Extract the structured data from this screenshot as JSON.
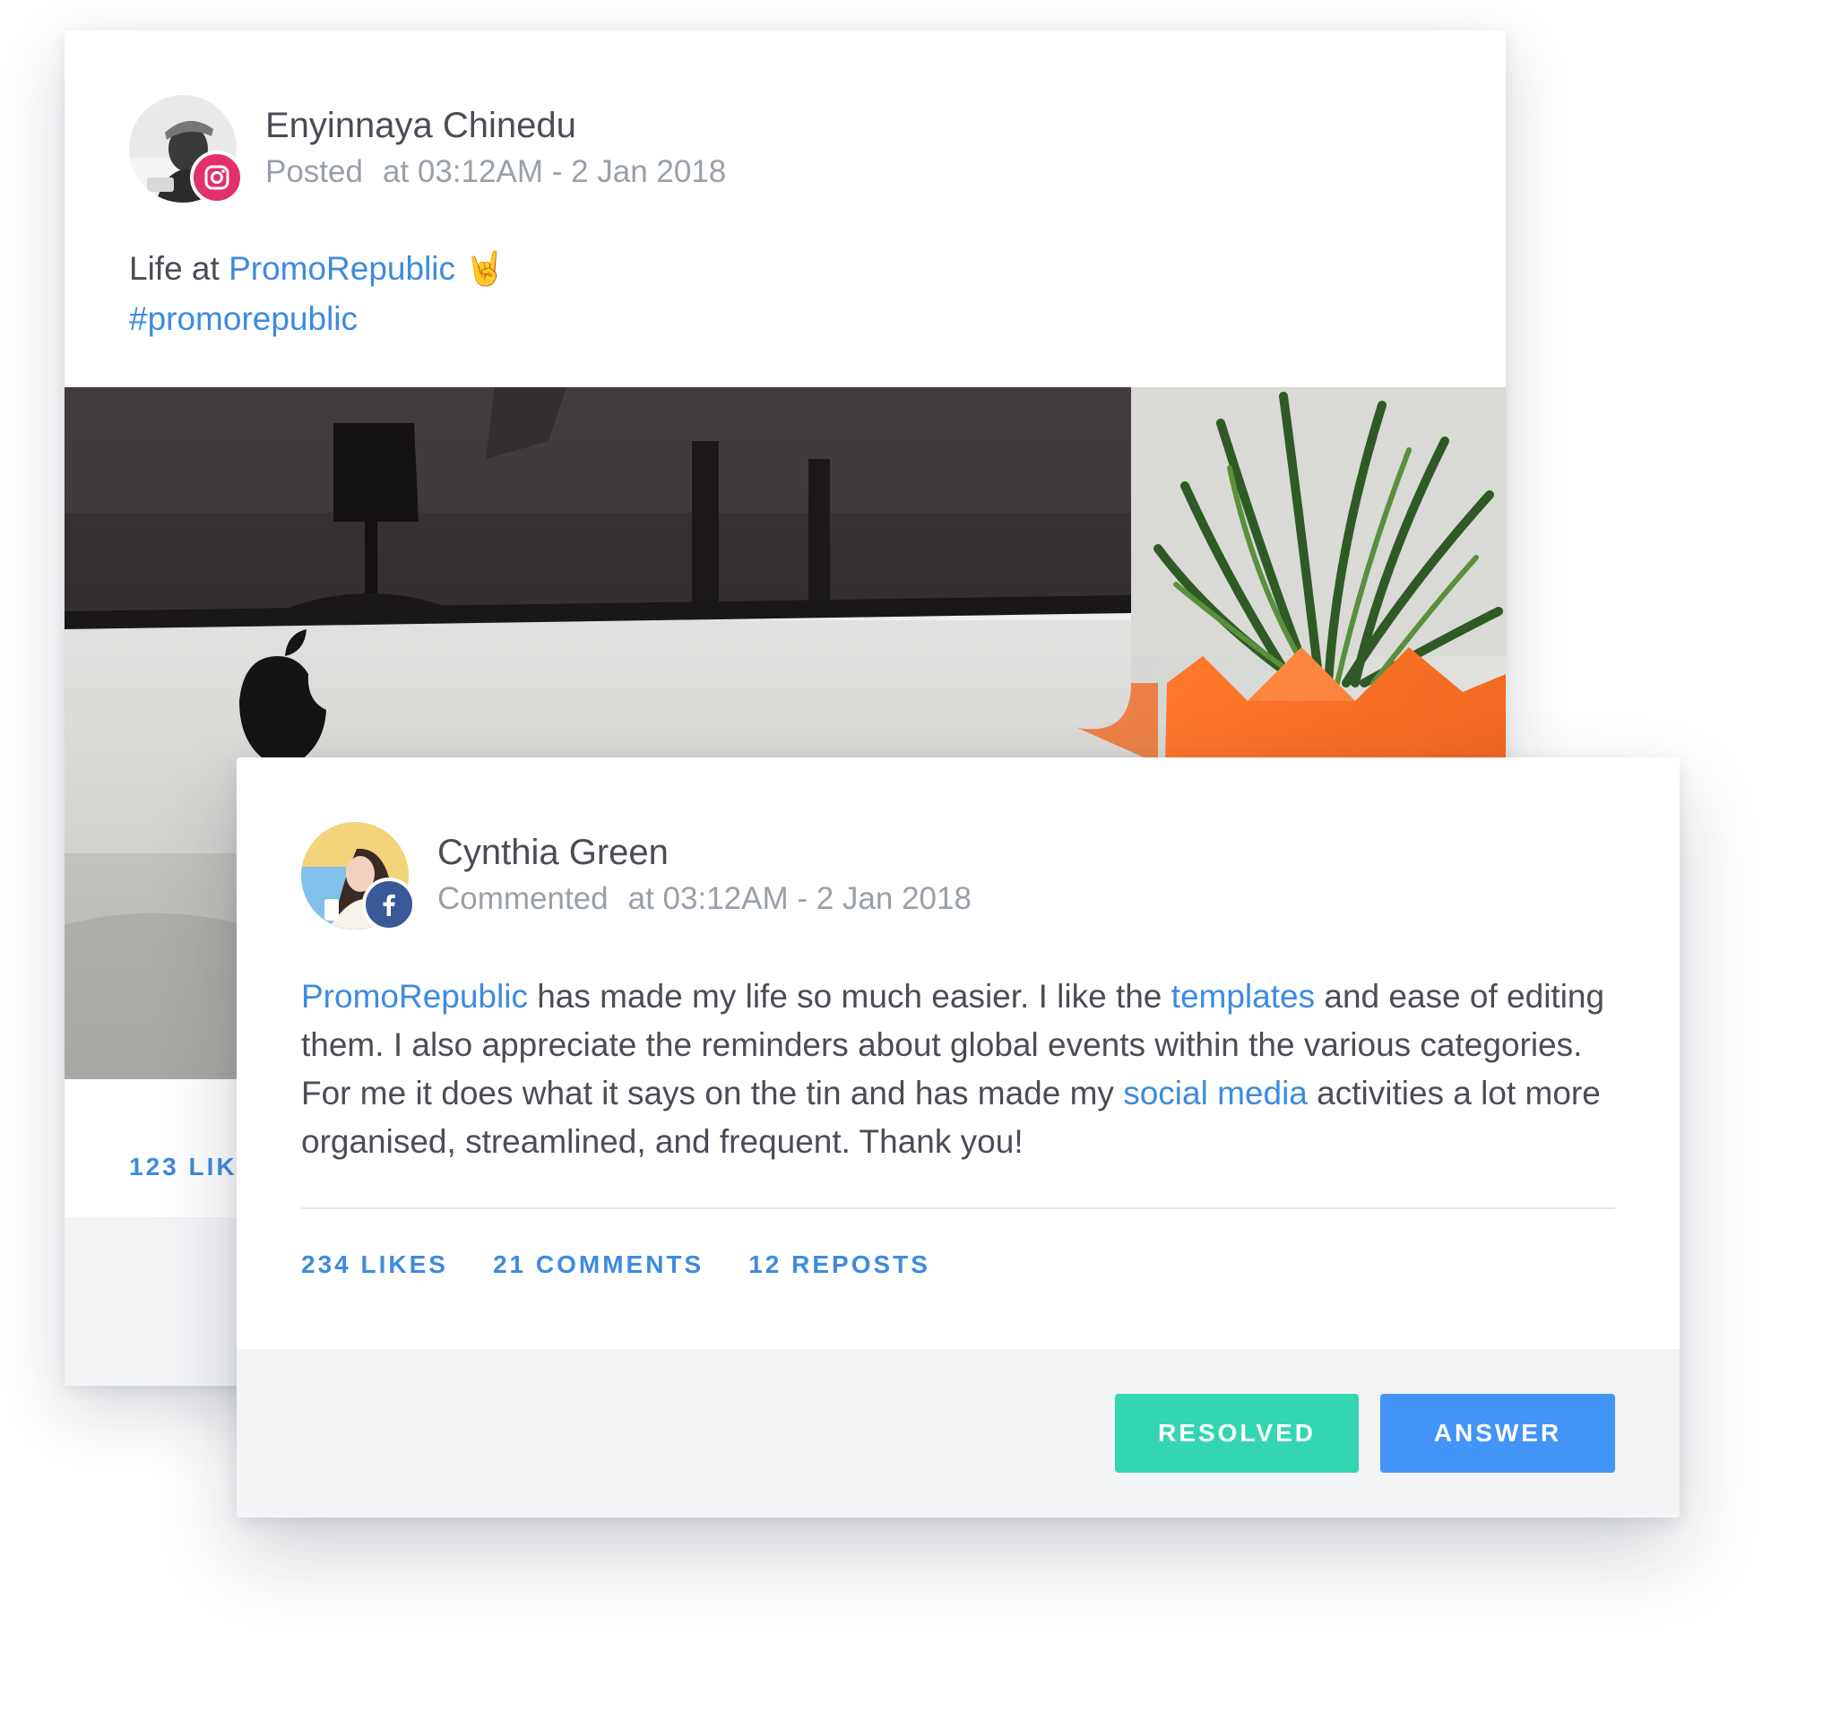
{
  "post": {
    "author_name": "Enyinnaya Chinedu",
    "action": "Posted",
    "timestamp": "at 03:12AM - 2 Jan 2018",
    "network_icon": "instagram-icon",
    "text_prefix": "Life at ",
    "brand_link": "PromoRepublic",
    "emoji": "🤘",
    "hashtag": "#promorepublic",
    "likes_partial": "123 LIK"
  },
  "comment": {
    "author_name": "Cynthia Green",
    "action": "Commented",
    "timestamp": "at 03:12AM - 2 Jan 2018",
    "network_icon": "facebook-icon",
    "text": {
      "link_1": "PromoRepublic",
      "part_1": " has made my life so much easier. I like the ",
      "link_2": "templates",
      "part_2": " and ease of editing them. I also appreciate the reminders about global events within the various categories. For me it does what it says on the tin and has made my ",
      "link_3": "social media",
      "part_3": " activities a lot more organised, streamlined, and frequent. Thank you!"
    },
    "stats": {
      "likes": "234 LIKES",
      "comments": "21 COMMENTS",
      "reposts": "12 REPOSTS"
    },
    "buttons": {
      "resolved": "RESOLVED",
      "answer": "ANSWER"
    }
  },
  "colors": {
    "link": "#3d8be0",
    "resolved": "#33d6b0",
    "answer": "#4294f6",
    "instagram": "#e1306c",
    "facebook": "#3b5998"
  }
}
